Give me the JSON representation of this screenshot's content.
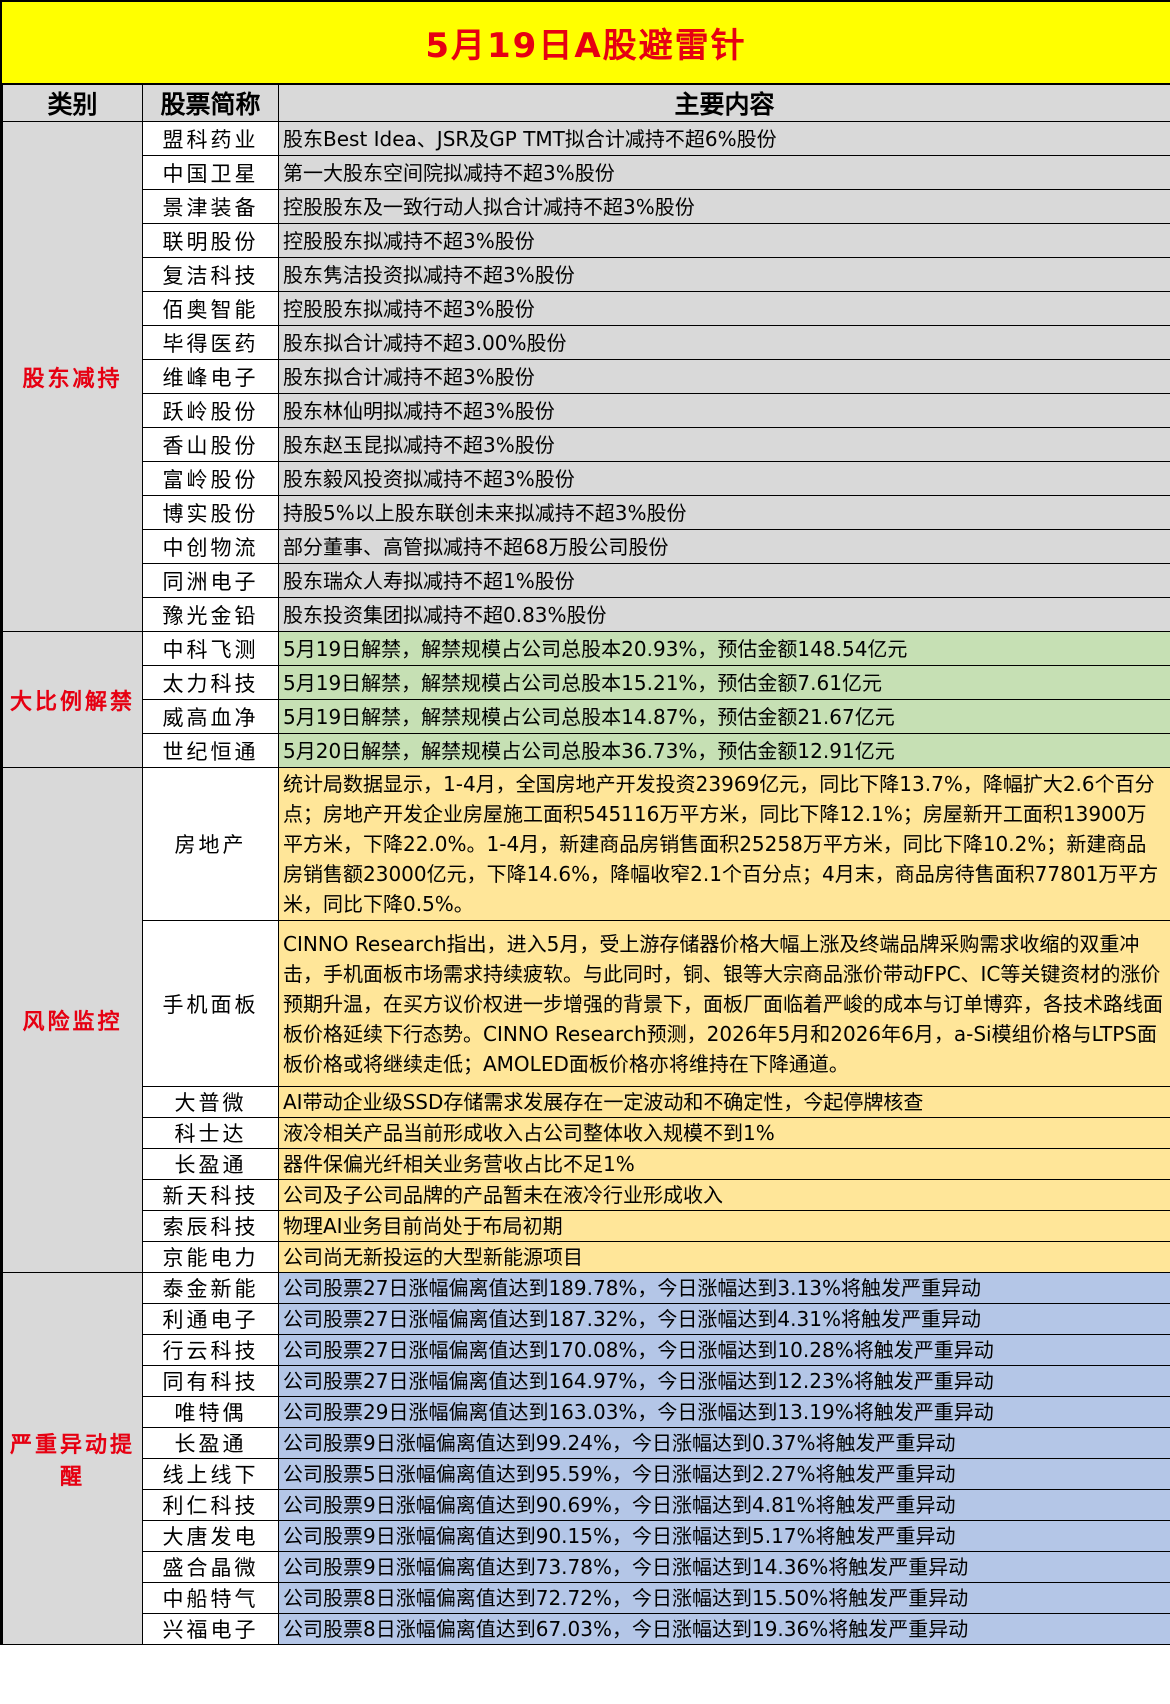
{
  "title": "5月19日A股避雷针",
  "headers": {
    "category": "类别",
    "stock": "股票简称",
    "content": "主要内容"
  },
  "sections": [
    {
      "category": "股东减持",
      "color": "#d9d9d9",
      "rows": [
        {
          "name": "盟科药业",
          "content": "股东Best Idea、JSR及GP TMT拟合计减持不超6%股份"
        },
        {
          "name": "中国卫星",
          "content": "第一大股东空间院拟减持不超3%股份"
        },
        {
          "name": "景津装备",
          "content": "控股股东及一致行动人拟合计减持不超3%股份"
        },
        {
          "name": "联明股份",
          "content": "控股股东拟减持不超3%股份"
        },
        {
          "name": "复洁科技",
          "content": "股东隽洁投资拟减持不超3%股份"
        },
        {
          "name": "佰奥智能",
          "content": "控股股东拟减持不超3%股份"
        },
        {
          "name": "毕得医药",
          "content": "股东拟合计减持不超3.00%股份"
        },
        {
          "name": "维峰电子",
          "content": "股东拟合计减持不超3%股份"
        },
        {
          "name": "跃岭股份",
          "content": "股东林仙明拟减持不超3%股份"
        },
        {
          "name": "香山股份",
          "content": "股东赵玉昆拟减持不超3%股份"
        },
        {
          "name": "富岭股份",
          "content": "股东毅风投资拟减持不超3%股份"
        },
        {
          "name": "博实股份",
          "content": "持股5%以上股东联创未来拟减持不超3%股份"
        },
        {
          "name": "中创物流",
          "content": "部分董事、高管拟减持不超68万股公司股份"
        },
        {
          "name": "同洲电子",
          "content": "股东瑞众人寿拟减持不超1%股份"
        },
        {
          "name": "豫光金铅",
          "content": "股东投资集团拟减持不超0.83%股份"
        }
      ]
    },
    {
      "category": "大比例解禁",
      "color": "#c6e0b4",
      "rows": [
        {
          "name": "中科飞测",
          "content": "5月19日解禁，解禁规模占公司总股本20.93%，预估金额148.54亿元"
        },
        {
          "name": "太力科技",
          "content": "5月19日解禁，解禁规模占公司总股本15.21%，预估金额7.61亿元"
        },
        {
          "name": "威高血净",
          "content": "5月19日解禁，解禁规模占公司总股本14.87%，预估金额21.67亿元"
        },
        {
          "name": "世纪恒通",
          "content": "5月20日解禁，解禁规模占公司总股本36.73%，预估金额12.91亿元"
        }
      ]
    },
    {
      "category": "风险监控",
      "color": "#ffe699",
      "rows": [
        {
          "name": "房地产",
          "content": "统计局数据显示，1-4月，全国房地产开发投资23969亿元，同比下降13.7%，降幅扩大2.6个百分点；房地产开发企业房屋施工面积545116万平方米，同比下降12.1%；房屋新开工面积13900万平方米，下降22.0%。1-4月，新建商品房销售面积25258万平方米，同比下降10.2%；新建商品房销售额23000亿元，下降14.6%，降幅收窄2.1个百分点；4月末，商品房待售面积77801万平方米，同比下降0.5%。"
        },
        {
          "name": "手机面板",
          "content": "CINNO Research指出，进入5月，受上游存储器价格大幅上涨及终端品牌采购需求收缩的双重冲击，手机面板市场需求持续疲软。与此同时，铜、银等大宗商品涨价带动FPC、IC等关键资材的涨价预期升温，在买方议价权进一步增强的背景下，面板厂面临着严峻的成本与订单博弈，各技术路线面板价格延续下行态势。CINNO Research预测，2026年5月和2026年6月，a-Si模组价格与LTPS面板价格或将继续走低；AMOLED面板价格亦将维持在下降通道。"
        },
        {
          "name": "大普微",
          "content": "AI带动企业级SSD存储需求发展存在一定波动和不确定性，今起停牌核查"
        },
        {
          "name": "科士达",
          "content": "液冷相关产品当前形成收入占公司整体收入规模不到1%"
        },
        {
          "name": "长盈通",
          "content": "器件保偏光纤相关业务营收占比不足1%"
        },
        {
          "name": "新天科技",
          "content": "公司及子公司品牌的产品暂未在液冷行业形成收入"
        },
        {
          "name": "索辰科技",
          "content": "物理AI业务目前尚处于布局初期"
        },
        {
          "name": "京能电力",
          "content": "公司尚无新投运的大型新能源项目"
        }
      ]
    },
    {
      "category": "严重异动提醒",
      "color": "#b4c6e7",
      "rows": [
        {
          "name": "泰金新能",
          "content": "公司股票27日涨幅偏离值达到189.78%，今日涨幅达到3.13%将触发严重异动"
        },
        {
          "name": "利通电子",
          "content": "公司股票27日涨幅偏离值达到187.32%，今日涨幅达到4.31%将触发严重异动"
        },
        {
          "name": "行云科技",
          "content": "公司股票27日涨幅偏离值达到170.08%，今日涨幅达到10.28%将触发严重异动"
        },
        {
          "name": "同有科技",
          "content": "公司股票27日涨幅偏离值达到164.97%，今日涨幅达到12.23%将触发严重异动"
        },
        {
          "name": "唯特偶",
          "content": "公司股票29日涨幅偏离值达到163.03%，今日涨幅达到13.19%将触发严重异动"
        },
        {
          "name": "长盈通",
          "content": "公司股票9日涨幅偏离值达到99.24%，今日涨幅达到0.37%将触发严重异动"
        },
        {
          "name": "线上线下",
          "content": "公司股票5日涨幅偏离值达到95.59%，今日涨幅达到2.27%将触发严重异动"
        },
        {
          "name": "利仁科技",
          "content": "公司股票9日涨幅偏离值达到90.69%，今日涨幅达到4.81%将触发严重异动"
        },
        {
          "name": "大唐发电",
          "content": "公司股票9日涨幅偏离值达到90.15%，今日涨幅达到5.17%将触发严重异动"
        },
        {
          "name": "盛合晶微",
          "content": "公司股票9日涨幅偏离值达到73.78%，今日涨幅达到14.36%将触发严重异动"
        },
        {
          "name": "中船特气",
          "content": "公司股票8日涨幅偏离值达到72.72%，今日涨幅达到15.50%将触发严重异动"
        },
        {
          "name": "兴福电子",
          "content": "公司股票8日涨幅偏离值达到67.03%，今日涨幅达到19.36%将触发严重异动"
        }
      ]
    }
  ]
}
